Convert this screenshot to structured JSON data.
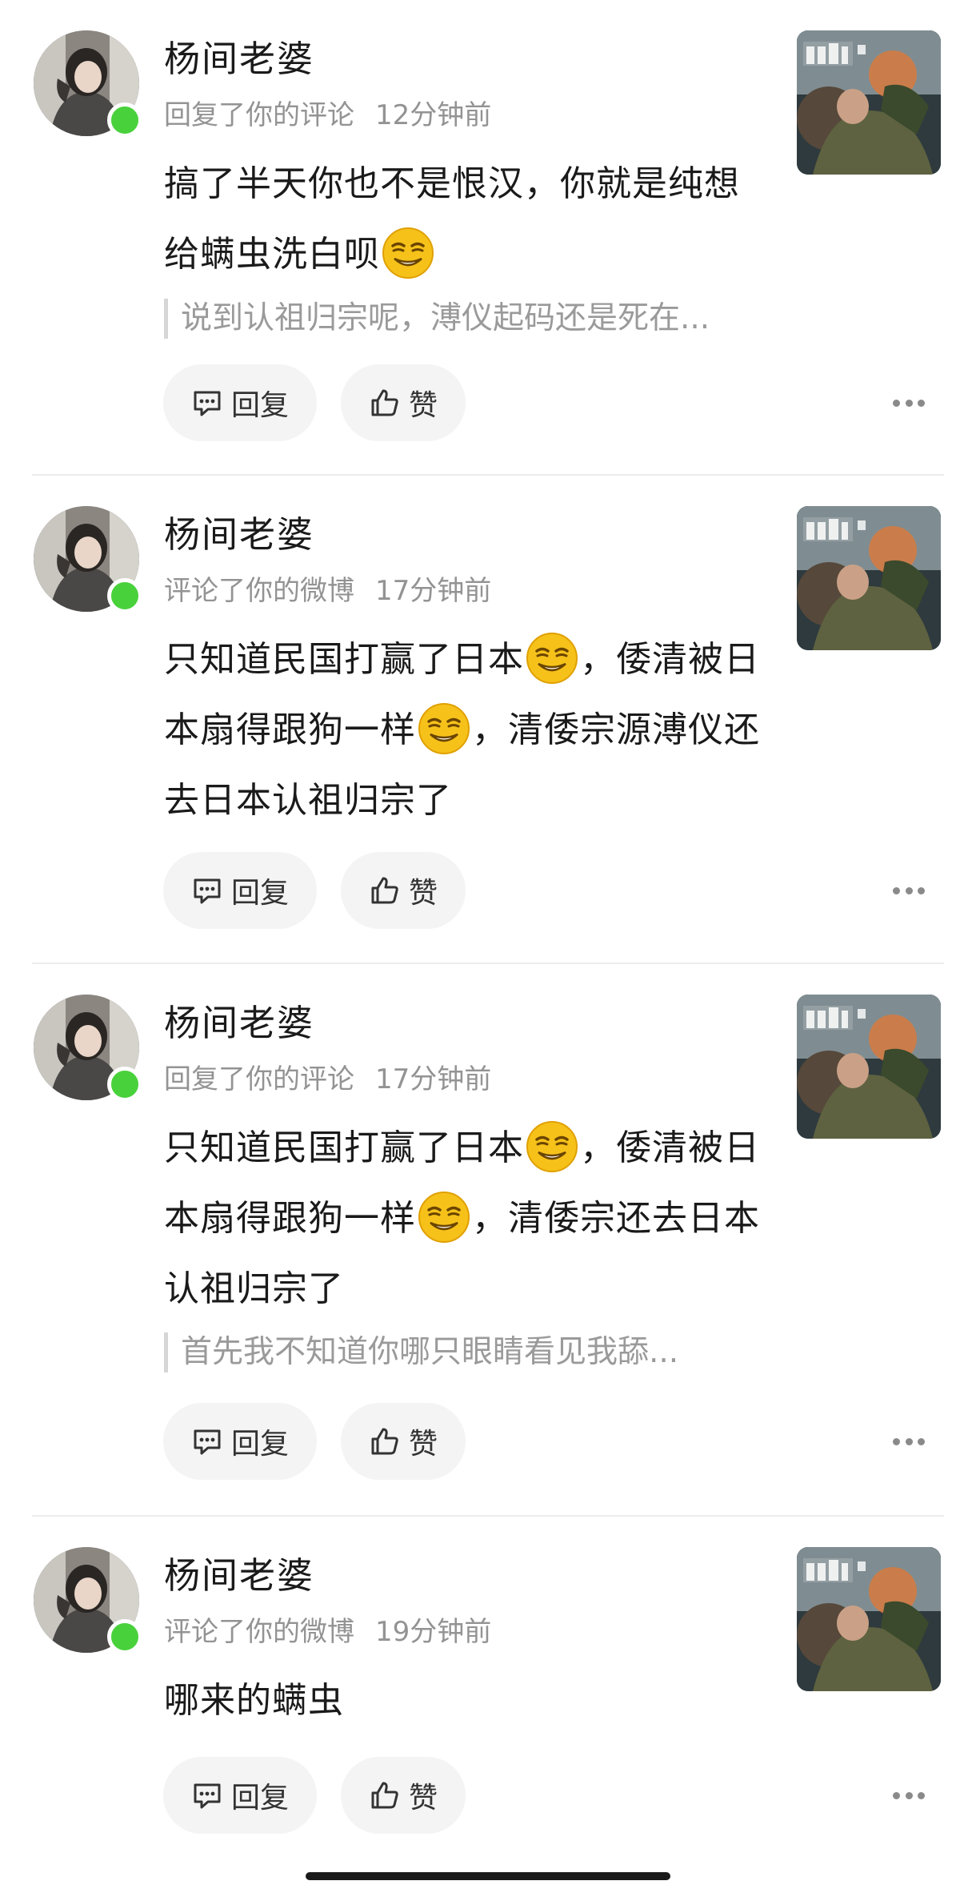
{
  "notifications": [
    {
      "username": "杨间老婆",
      "action": "回复了你的评论",
      "time": "12分钟前",
      "content_parts": [
        "搞了半天你也不是恨汉，你就是纯想",
        "给螨虫洗白呗"
      ],
      "quote": "说到认祖归宗呢，溥仪起码还是死在..."
    },
    {
      "username": "杨间老婆",
      "action": "评论了你的微博",
      "time": "17分钟前",
      "content_parts": [
        "只知道民国打赢了日本",
        "，倭清被日",
        "本扇得跟狗一样",
        "，清倭宗源溥仪还",
        "去日本认祖归宗了"
      ]
    },
    {
      "username": "杨间老婆",
      "action": "回复了你的评论",
      "time": "17分钟前",
      "content_parts": [
        "只知道民国打赢了日本",
        "，倭清被日",
        "本扇得跟狗一样",
        "，清倭宗还去日本",
        "认祖归宗了"
      ],
      "quote": "首先我不知道你哪只眼睛看见我舔..."
    },
    {
      "username": "杨间老婆",
      "action": "评论了你的微博",
      "time": "19分钟前",
      "content_parts": [
        "哪来的螨虫"
      ]
    }
  ],
  "actions": {
    "reply_label": "回复",
    "like_label": "赞"
  },
  "icons": {
    "reply": "comment-bubble-icon",
    "like": "thumbs-up-icon",
    "more": "more-dots-icon",
    "emoji": "smirk-emoji-icon"
  },
  "colors": {
    "online": "#49d13c",
    "meta_text": "#939393",
    "button_bg": "#f4f4f4"
  }
}
